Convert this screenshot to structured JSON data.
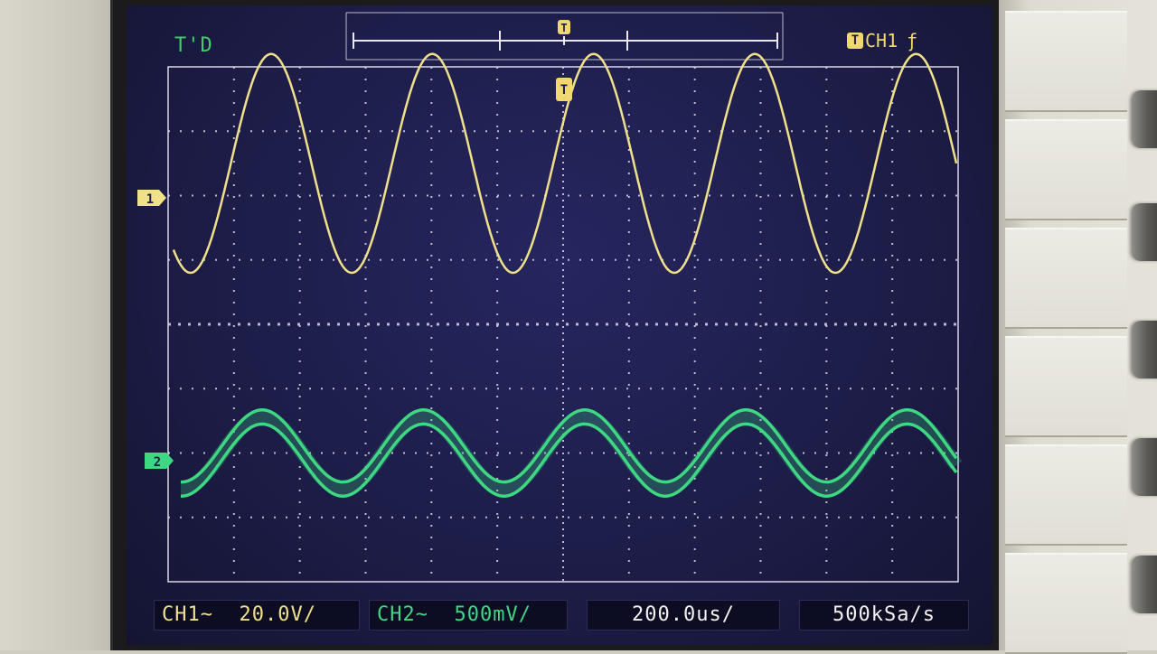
{
  "screen": {
    "timebase_mode": "T'D",
    "trigger_marker": "T",
    "trigger_source": "CH1",
    "trigger_slope_icon": "rising-edge-icon",
    "ch1_marker": "1",
    "ch2_marker": "2"
  },
  "status_bar": {
    "ch1": "CH1~  20.0V/",
    "ch2": "CH2~  500mV/",
    "timebase": "200.0us/",
    "sample_rate": "500kSa/s"
  },
  "colors": {
    "background": "#1d1d48",
    "grid": "#d8d8e8",
    "ch1": "#f0e08a",
    "ch2": "#3ed883",
    "label_green": "#3fcf6a"
  },
  "chart_data": {
    "type": "line",
    "grid": {
      "divisions_x": 12,
      "divisions_y": 8
    },
    "series": [
      {
        "name": "CH1",
        "shape": "sine",
        "cycles": 4.9,
        "amplitude_div": 1.7,
        "offset_div": 2.5,
        "phase_deg": 220
      },
      {
        "name": "CH2",
        "shape": "sine",
        "cycles": 4.9,
        "amplitude_div": 0.56,
        "offset_div": -2.0,
        "phase_deg": 240,
        "thickness_div": 0.22
      }
    ]
  }
}
